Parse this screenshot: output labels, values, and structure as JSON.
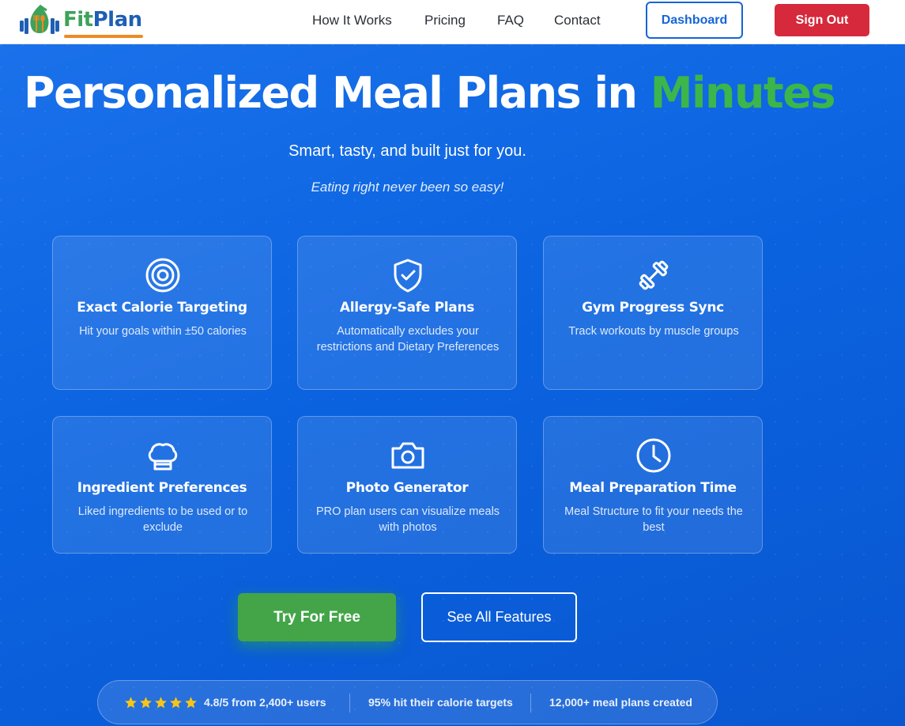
{
  "brand": {
    "name_part1": "Fit",
    "name_part2": "Plan",
    "logo_icon": "leaf-dumbbell-cutlery-icon",
    "colors": {
      "green": "#3da35a",
      "blue": "#1e5fb4",
      "orange": "#f08a24"
    }
  },
  "nav": {
    "links": [
      "How It Works",
      "Pricing",
      "FAQ",
      "Contact"
    ],
    "dashboard_label": "Dashboard",
    "signout_label": "Sign Out"
  },
  "hero": {
    "title_main": "Personalized Meal Plans in",
    "title_accent": "Minutes",
    "subtitle": "Smart, tasty, and built just for you.",
    "tagline": "Eating right never been so easy!"
  },
  "features": [
    {
      "icon": "target-icon",
      "title": "Exact Calorie Targeting",
      "desc": "Hit your goals within ±50 calories"
    },
    {
      "icon": "shield-check-icon",
      "title": "Allergy-Safe Plans",
      "desc": "Automatically excludes your restrictions and Dietary Preferences"
    },
    {
      "icon": "dumbbell-icon",
      "title": "Gym Progress Sync",
      "desc": "Track workouts by muscle groups"
    },
    {
      "icon": "chef-hat-icon",
      "title": "Ingredient Preferences",
      "desc": "Liked ingredients to be used or to exclude"
    },
    {
      "icon": "camera-icon",
      "title": "Photo Generator",
      "desc": "PRO plan users can visualize meals with photos"
    },
    {
      "icon": "clock-icon",
      "title": "Meal Preparation Time",
      "desc": "Meal Structure to fit your needs the best"
    }
  ],
  "cta": {
    "primary_label": "Try For Free",
    "secondary_label": "See All Features"
  },
  "stats": {
    "rating_stars": 5,
    "rating_text": "4.8/5 from 2,400+ users",
    "calorie_text": "95% hit their calorie targets",
    "plans_text": "12,000+ meal plans created"
  },
  "colors": {
    "background": "#0a63e0",
    "accent_green": "#3cb54a",
    "signout_red": "#d6293b",
    "star_yellow": "#f5c518"
  }
}
